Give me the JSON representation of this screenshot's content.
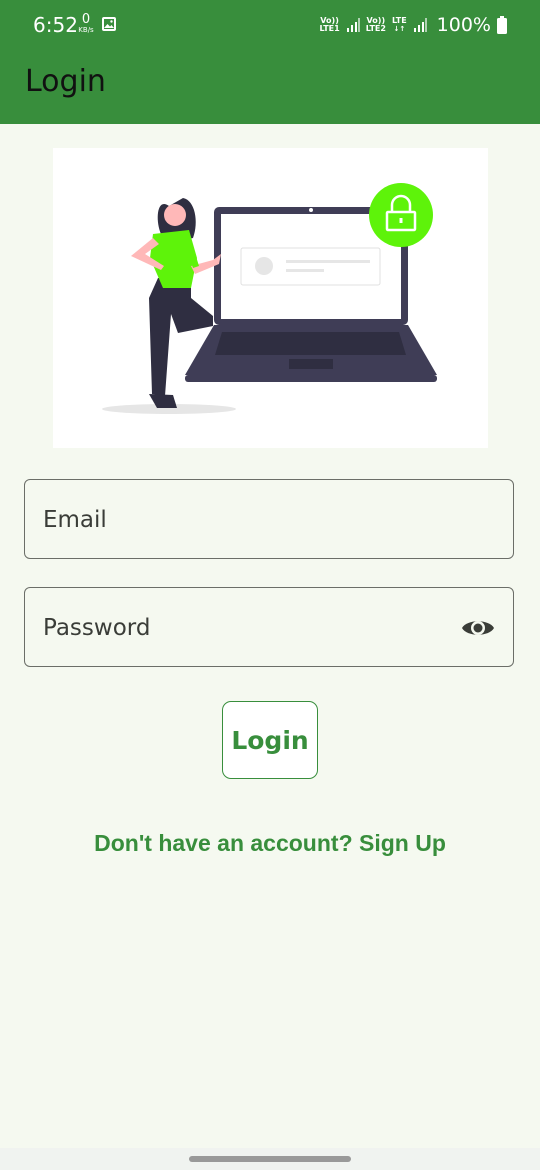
{
  "status_bar": {
    "time": "6:52",
    "net_speed_value": "0",
    "net_speed_unit": "KB/s",
    "sim1_top": "Vo))",
    "sim1_bottom": "LTE1",
    "sim2_top": "Vo))",
    "sim2_bottom": "LTE2",
    "sim2_data": "LTE",
    "battery": "100%"
  },
  "app_bar": {
    "title": "Login"
  },
  "form": {
    "email_label": "Email",
    "password_label": "Password",
    "login_label": "Login",
    "signup_link": "Don't have an account? Sign Up"
  },
  "colors": {
    "primary": "#388e3c",
    "accent_green": "#5ef30a",
    "background": "#f5f9f0"
  },
  "icons": [
    "gallery-icon",
    "signal-icon",
    "battery-icon",
    "eye-icon",
    "lock-icon"
  ]
}
